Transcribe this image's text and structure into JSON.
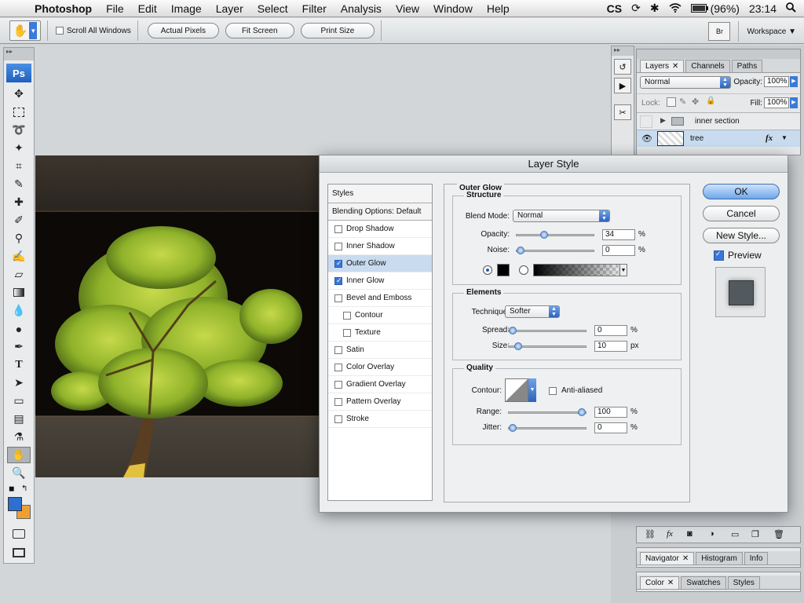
{
  "menubar": {
    "app": "Photoshop",
    "items": [
      "File",
      "Edit",
      "Image",
      "Layer",
      "Select",
      "Filter",
      "Analysis",
      "View",
      "Window",
      "Help"
    ],
    "battery": "(96%)",
    "clock": "23:14",
    "status_cs": "CS"
  },
  "optbar": {
    "scroll_all_windows": "Scroll All Windows",
    "actual_pixels": "Actual Pixels",
    "fit_screen": "Fit Screen",
    "print_size": "Print Size",
    "workspace": "Workspace",
    "bridge_label": "Br"
  },
  "toolbox": {
    "logo": "Ps"
  },
  "layers_panel": {
    "tabs": [
      "Layers",
      "Channels",
      "Paths"
    ],
    "blend_mode": "Normal",
    "opacity_label": "Opacity:",
    "opacity_value": "100%",
    "lock_label": "Lock:",
    "fill_label": "Fill:",
    "fill_value": "100%",
    "layers": [
      {
        "name": "inner section"
      },
      {
        "name": "tree",
        "fx": "fx"
      }
    ]
  },
  "navigator_panel": {
    "tabs": [
      "Navigator",
      "Histogram",
      "Info"
    ]
  },
  "color_panel": {
    "tabs": [
      "Color",
      "Swatches",
      "Styles"
    ]
  },
  "dialog": {
    "title": "Layer Style",
    "styles_header": "Styles",
    "blending_options": "Blending Options: Default",
    "styles": [
      {
        "label": "Drop Shadow",
        "checked": false,
        "sub": false
      },
      {
        "label": "Inner Shadow",
        "checked": false,
        "sub": false
      },
      {
        "label": "Outer Glow",
        "checked": true,
        "sub": false,
        "selected": true
      },
      {
        "label": "Inner Glow",
        "checked": true,
        "sub": false
      },
      {
        "label": "Bevel and Emboss",
        "checked": false,
        "sub": false
      },
      {
        "label": "Contour",
        "checked": false,
        "sub": true
      },
      {
        "label": "Texture",
        "checked": false,
        "sub": true
      },
      {
        "label": "Satin",
        "checked": false,
        "sub": false
      },
      {
        "label": "Color Overlay",
        "checked": false,
        "sub": false
      },
      {
        "label": "Gradient Overlay",
        "checked": false,
        "sub": false
      },
      {
        "label": "Pattern Overlay",
        "checked": false,
        "sub": false
      },
      {
        "label": "Stroke",
        "checked": false,
        "sub": false
      }
    ],
    "section_title": "Outer Glow",
    "structure": {
      "title": "Structure",
      "blend_mode_label": "Blend Mode:",
      "blend_mode": "Normal",
      "opacity_label": "Opacity:",
      "opacity": "34",
      "opacity_level": 0.34,
      "noise_label": "Noise:",
      "noise": "0",
      "noise_level": 0,
      "pct": "%"
    },
    "elements": {
      "title": "Elements",
      "technique_label": "Technique:",
      "technique": "Softer",
      "spread_label": "Spread:",
      "spread": "0",
      "spread_level": 0,
      "size_label": "Size:",
      "size": "10",
      "size_level": 0.08,
      "pct": "%",
      "px": "px"
    },
    "quality": {
      "title": "Quality",
      "contour_label": "Contour:",
      "anti_aliased": "Anti-aliased",
      "range_label": "Range:",
      "range": "100",
      "range_level": 1,
      "jitter_label": "Jitter:",
      "jitter": "0",
      "jitter_level": 0,
      "pct": "%"
    },
    "buttons": {
      "ok": "OK",
      "cancel": "Cancel",
      "new_style": "New Style...",
      "preview": "Preview"
    }
  },
  "colors": {
    "foreground": "#2f6fd0",
    "background": "#f0a030",
    "accent": "#3b77d6"
  }
}
